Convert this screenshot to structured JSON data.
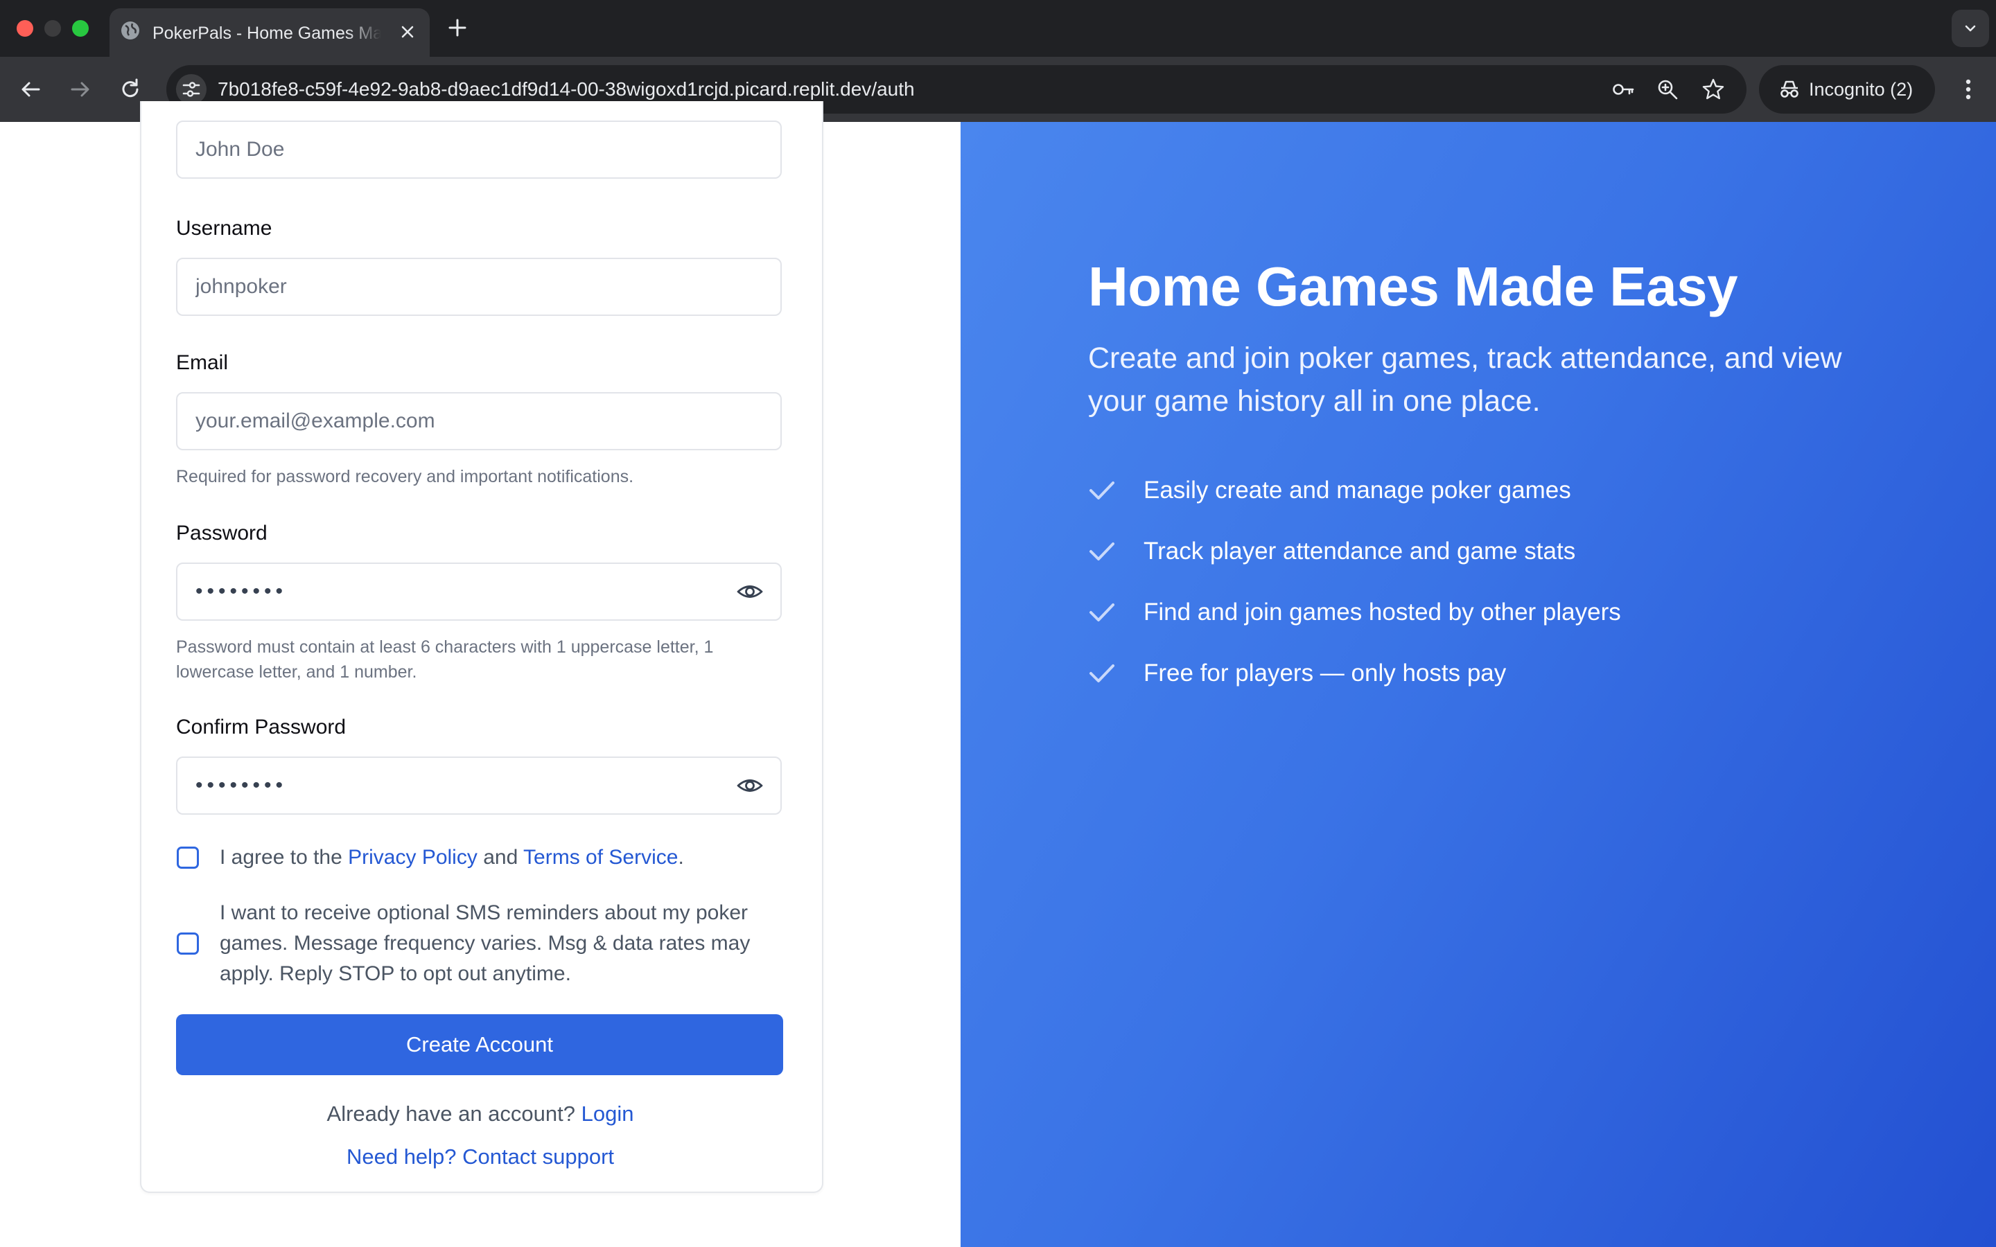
{
  "browser": {
    "tab_title": "PokerPals - Home Games Made Easy",
    "url_host": "7b018fe8-c59f-4e92-9ab8-d9aec1df9d14-00-38wigoxd1rcjd.picard.replit.dev",
    "url_path": "/auth",
    "incognito_label": "Incognito (2)"
  },
  "form": {
    "fullname_placeholder": "John Doe",
    "username_label": "Username",
    "username_placeholder": "johnpoker",
    "email_label": "Email",
    "email_placeholder": "your.email@example.com",
    "email_hint": "Required for password recovery and important notifications.",
    "password_label": "Password",
    "password_value": "••••••••",
    "password_hint": "Password must contain at least 6 characters with 1 uppercase letter, 1 lowercase letter, and 1 number.",
    "confirm_label": "Confirm Password",
    "confirm_value": "••••••••",
    "agree_prefix": "I agree to the ",
    "privacy_link": "Privacy Policy",
    "agree_and": " and ",
    "terms_link": "Terms of Service",
    "agree_suffix": ".",
    "sms_text": "I want to receive optional SMS reminders about my poker games. Message frequency varies. Msg & data rates may apply. Reply STOP to opt out anytime.",
    "submit_label": "Create Account",
    "have_account_text": "Already have an account? ",
    "login_link": "Login",
    "help_link": "Need help? Contact support"
  },
  "hero": {
    "title": "Home Games Made Easy",
    "subtitle": "Create and join poker games, track attendance, and view your game history all in one place.",
    "features": [
      "Easily create and manage poker games",
      "Track player attendance and game stats",
      "Find and join games hosted by other players",
      "Free for players — only hosts pay"
    ]
  },
  "colors": {
    "primary": "#2f66e0",
    "link": "#2458d3",
    "hero_gradient_start": "#4a86ee",
    "hero_gradient_end": "#2350d1"
  }
}
